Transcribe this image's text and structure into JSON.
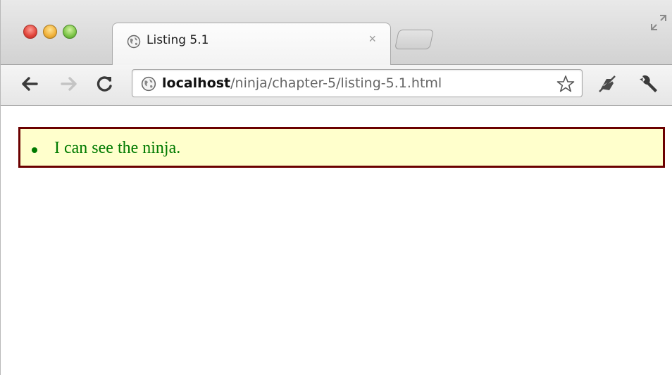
{
  "window": {
    "controls": [
      "close",
      "minimize",
      "zoom"
    ],
    "resize_icon": "fullscreen-icon"
  },
  "tab": {
    "title": "Listing 5.1",
    "close_glyph": "×",
    "favicon": "globe-icon"
  },
  "toolbar": {
    "back_icon": "back-arrow-icon",
    "forward_icon": "forward-arrow-icon",
    "reload_icon": "reload-icon",
    "url_host": "localhost",
    "url_path": "/ninja/chapter-5/listing-5.1.html",
    "bookmark_icon": "star-icon",
    "extension_icon": "extension-icon",
    "menu_icon": "wrench-icon"
  },
  "page": {
    "results": [
      {
        "text": "I can see the ninja.",
        "status": "pass"
      }
    ],
    "colors": {
      "pass_text": "#007a00",
      "box_background": "#ffffcc",
      "box_border": "#6b0000"
    }
  }
}
